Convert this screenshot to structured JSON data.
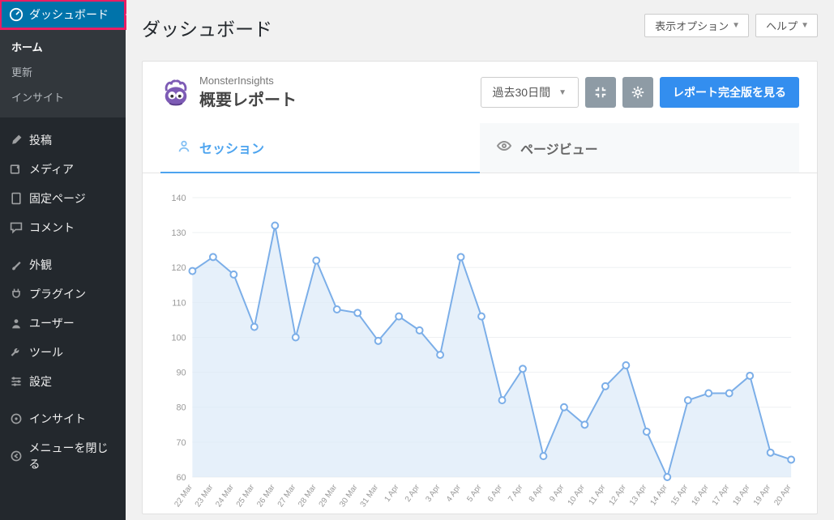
{
  "sidebar": {
    "dashboard": "ダッシュボード",
    "sub": {
      "home": "ホーム",
      "updates": "更新",
      "insights": "インサイト"
    },
    "items": {
      "posts": "投稿",
      "media": "メディア",
      "pages": "固定ページ",
      "comments": "コメント",
      "appearance": "外観",
      "plugins": "プラグイン",
      "users": "ユーザー",
      "tools": "ツール",
      "settings": "設定",
      "insights2": "インサイト",
      "collapse": "メニューを閉じる"
    }
  },
  "topbar": {
    "screen_options": "表示オプション",
    "help": "ヘルプ"
  },
  "page": {
    "title": "ダッシュボード"
  },
  "panel": {
    "brand_small": "MonsterInsights",
    "brand_big": "概要レポート",
    "range": "過去30日間",
    "full_report": "レポート完全版を見る"
  },
  "tabs": {
    "sessions": "セッション",
    "pageviews": "ページビュー"
  },
  "chart_data": {
    "type": "line",
    "title": "",
    "xlabel": "",
    "ylabel": "",
    "ylim": [
      60,
      140
    ],
    "yticks": [
      60,
      70,
      80,
      90,
      100,
      110,
      120,
      130,
      140
    ],
    "categories": [
      "22 Mar",
      "23 Mar",
      "24 Mar",
      "25 Mar",
      "26 Mar",
      "27 Mar",
      "28 Mar",
      "29 Mar",
      "30 Mar",
      "31 Mar",
      "1 Apr",
      "2 Apr",
      "3 Apr",
      "4 Apr",
      "5 Apr",
      "6 Apr",
      "7 Apr",
      "8 Apr",
      "9 Apr",
      "10 Apr",
      "11 Apr",
      "12 Apr",
      "13 Apr",
      "14 Apr",
      "15 Apr",
      "16 Apr",
      "17 Apr",
      "18 Apr",
      "19 Apr",
      "20 Apr"
    ],
    "series": [
      {
        "name": "セッション",
        "values": [
          119,
          123,
          118,
          103,
          132,
          100,
          122,
          108,
          107,
          99,
          106,
          102,
          95,
          123,
          106,
          82,
          91,
          66,
          80,
          75,
          86,
          92,
          73,
          60,
          82,
          84,
          84,
          89,
          67,
          65
        ]
      }
    ]
  }
}
